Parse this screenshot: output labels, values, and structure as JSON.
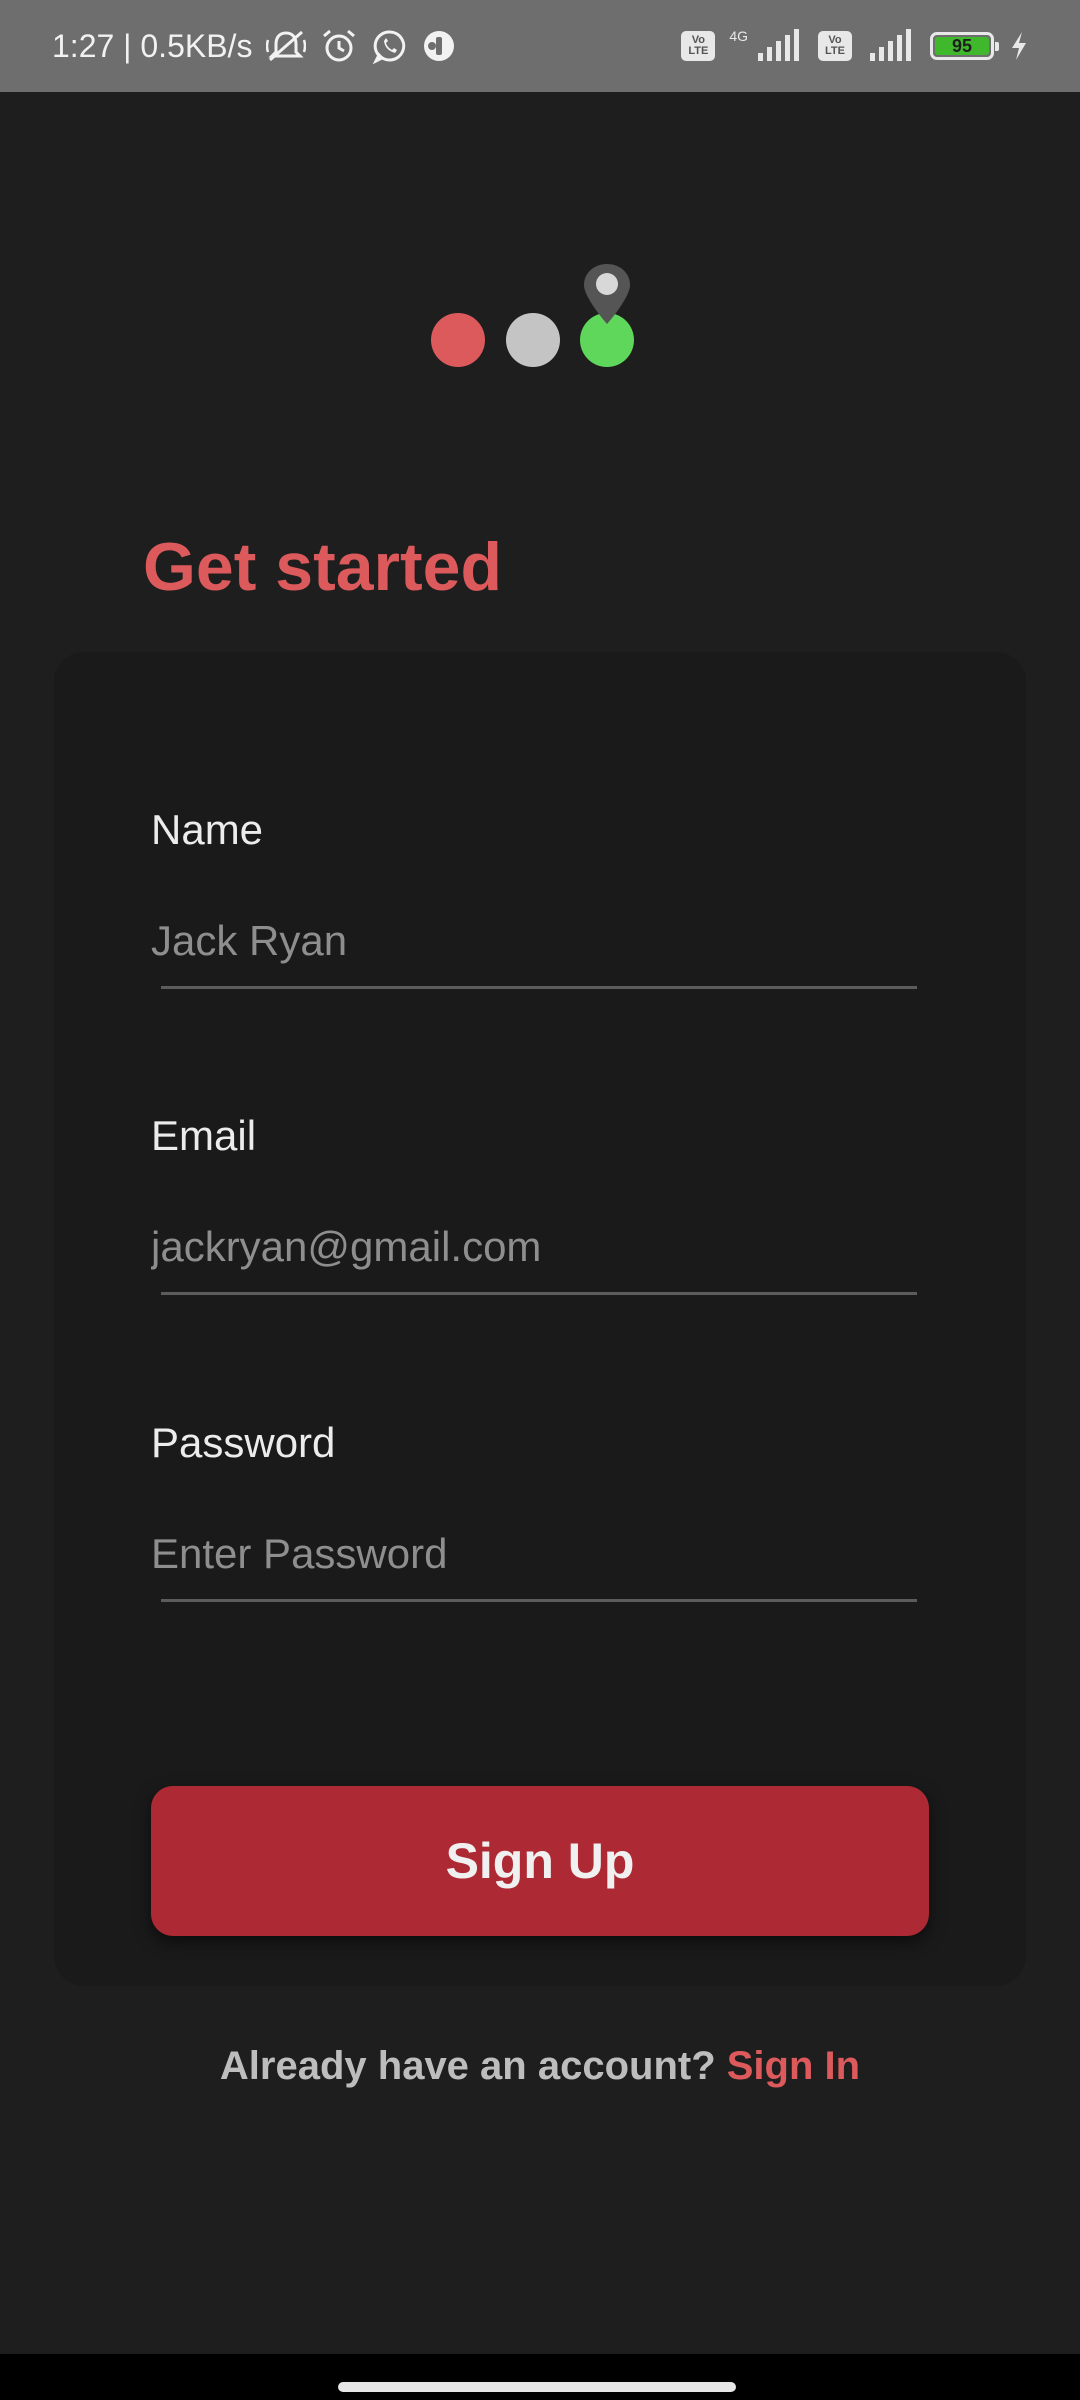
{
  "status_bar": {
    "time_speed": "1:27 | 0.5KB/s",
    "sim1_badge_top": "Vo",
    "sim1_badge_bottom": "LTE",
    "network_label": "4G",
    "sim2_badge_top": "Vo",
    "sim2_badge_bottom": "LTE",
    "battery_level": "95",
    "icons": [
      "mute-icon",
      "alarm-icon",
      "whatsapp-icon",
      "app-icon",
      "signal-icon",
      "charging-icon"
    ]
  },
  "logo": {
    "colors": {
      "red": "#dc5a5c",
      "grey": "#c4c4c4",
      "green": "#5ed75a",
      "pin": "#555555"
    }
  },
  "page": {
    "title": "Get started"
  },
  "form": {
    "name": {
      "label": "Name",
      "placeholder": "Jack Ryan"
    },
    "email": {
      "label": "Email",
      "placeholder": "jackryan@gmail.com"
    },
    "password": {
      "label": "Password",
      "placeholder": "Enter Password"
    },
    "submit_label": "Sign Up"
  },
  "footer": {
    "prompt": "Already have an account? ",
    "link_label": "Sign In"
  },
  "theme": {
    "accent": "#dc5a5c",
    "button": "#ad2a34",
    "background": "#1e1e1e",
    "card": "#1a1a1a"
  }
}
